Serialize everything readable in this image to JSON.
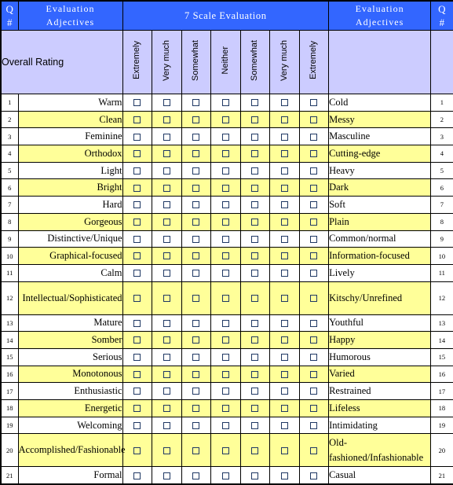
{
  "header": {
    "qnum_left": {
      "line1": "Q",
      "line2": "#"
    },
    "adjectives_left": {
      "line1": "Evaluation",
      "line2": "Adjectives"
    },
    "scale_title": "7 Scale Evaluation",
    "adjectives_right": {
      "line1": "Evaluation",
      "line2": "Adjectives"
    },
    "qnum_right": {
      "line1": "Q",
      "line2": "#"
    }
  },
  "subheader": {
    "overall_rating_label": "Overall Rating",
    "scale_labels": [
      "Extremely",
      "Very much",
      "Somewhat",
      "Neither",
      "Somewhat",
      "Very much",
      "Extremely"
    ]
  },
  "colors": {
    "header_blue": "#3366FF",
    "subheader_lavender": "#CCCCFF",
    "row_highlight_yellow": "#FFFF99",
    "row_plain_white": "#FFFFFF",
    "border_black": "#000000",
    "checkbox_border": "#1F3864"
  },
  "checkbox_icon": "empty-checkbox",
  "columns_per_row": 7,
  "rows": [
    {
      "q": "1",
      "left": "Warm",
      "right": "Cold",
      "shade": "white",
      "tall": false
    },
    {
      "q": "2",
      "left": "Clean",
      "right": "Messy",
      "shade": "yellow",
      "tall": false
    },
    {
      "q": "3",
      "left": "Feminine",
      "right": "Masculine",
      "shade": "white",
      "tall": false
    },
    {
      "q": "4",
      "left": "Orthodox",
      "right": "Cutting-edge",
      "shade": "yellow",
      "tall": false
    },
    {
      "q": "5",
      "left": "Light",
      "right": "Heavy",
      "shade": "white",
      "tall": false
    },
    {
      "q": "6",
      "left": "Bright",
      "right": "Dark",
      "shade": "yellow",
      "tall": false
    },
    {
      "q": "7",
      "left": "Hard",
      "right": "Soft",
      "shade": "white",
      "tall": false
    },
    {
      "q": "8",
      "left": "Gorgeous",
      "right": "Plain",
      "shade": "yellow",
      "tall": false
    },
    {
      "q": "9",
      "left": "Distinctive/Unique",
      "right": "Common/normal",
      "shade": "white",
      "tall": false
    },
    {
      "q": "10",
      "left": "Graphical-focused",
      "right": "Information-focused",
      "shade": "yellow",
      "tall": false
    },
    {
      "q": "11",
      "left": "Calm",
      "right": "Lively",
      "shade": "white",
      "tall": false
    },
    {
      "q": "12",
      "left": "Intellectual/Sophisticated",
      "right": "Kitschy/Unrefined",
      "shade": "yellow",
      "tall": true
    },
    {
      "q": "13",
      "left": "Mature",
      "right": "Youthful",
      "shade": "white",
      "tall": false
    },
    {
      "q": "14",
      "left": "Somber",
      "right": "Happy",
      "shade": "yellow",
      "tall": false
    },
    {
      "q": "15",
      "left": "Serious",
      "right": "Humorous",
      "shade": "white",
      "tall": false
    },
    {
      "q": "16",
      "left": "Monotonous",
      "right": "Varied",
      "shade": "yellow",
      "tall": false
    },
    {
      "q": "17",
      "left": "Enthusiastic",
      "right": "Restrained",
      "shade": "white",
      "tall": false
    },
    {
      "q": "18",
      "left": "Energetic",
      "right": "Lifeless",
      "shade": "yellow",
      "tall": false
    },
    {
      "q": "19",
      "left": "Welcoming",
      "right": "Intimidating",
      "shade": "white",
      "tall": false
    },
    {
      "q": "20",
      "left": "Accomplished/Fashionable",
      "right": "Old-fashioned/Infashionable",
      "shade": "yellow",
      "tall": true
    },
    {
      "q": "21",
      "left": "Formal",
      "right": "Casual",
      "shade": "white",
      "tall": false
    }
  ]
}
